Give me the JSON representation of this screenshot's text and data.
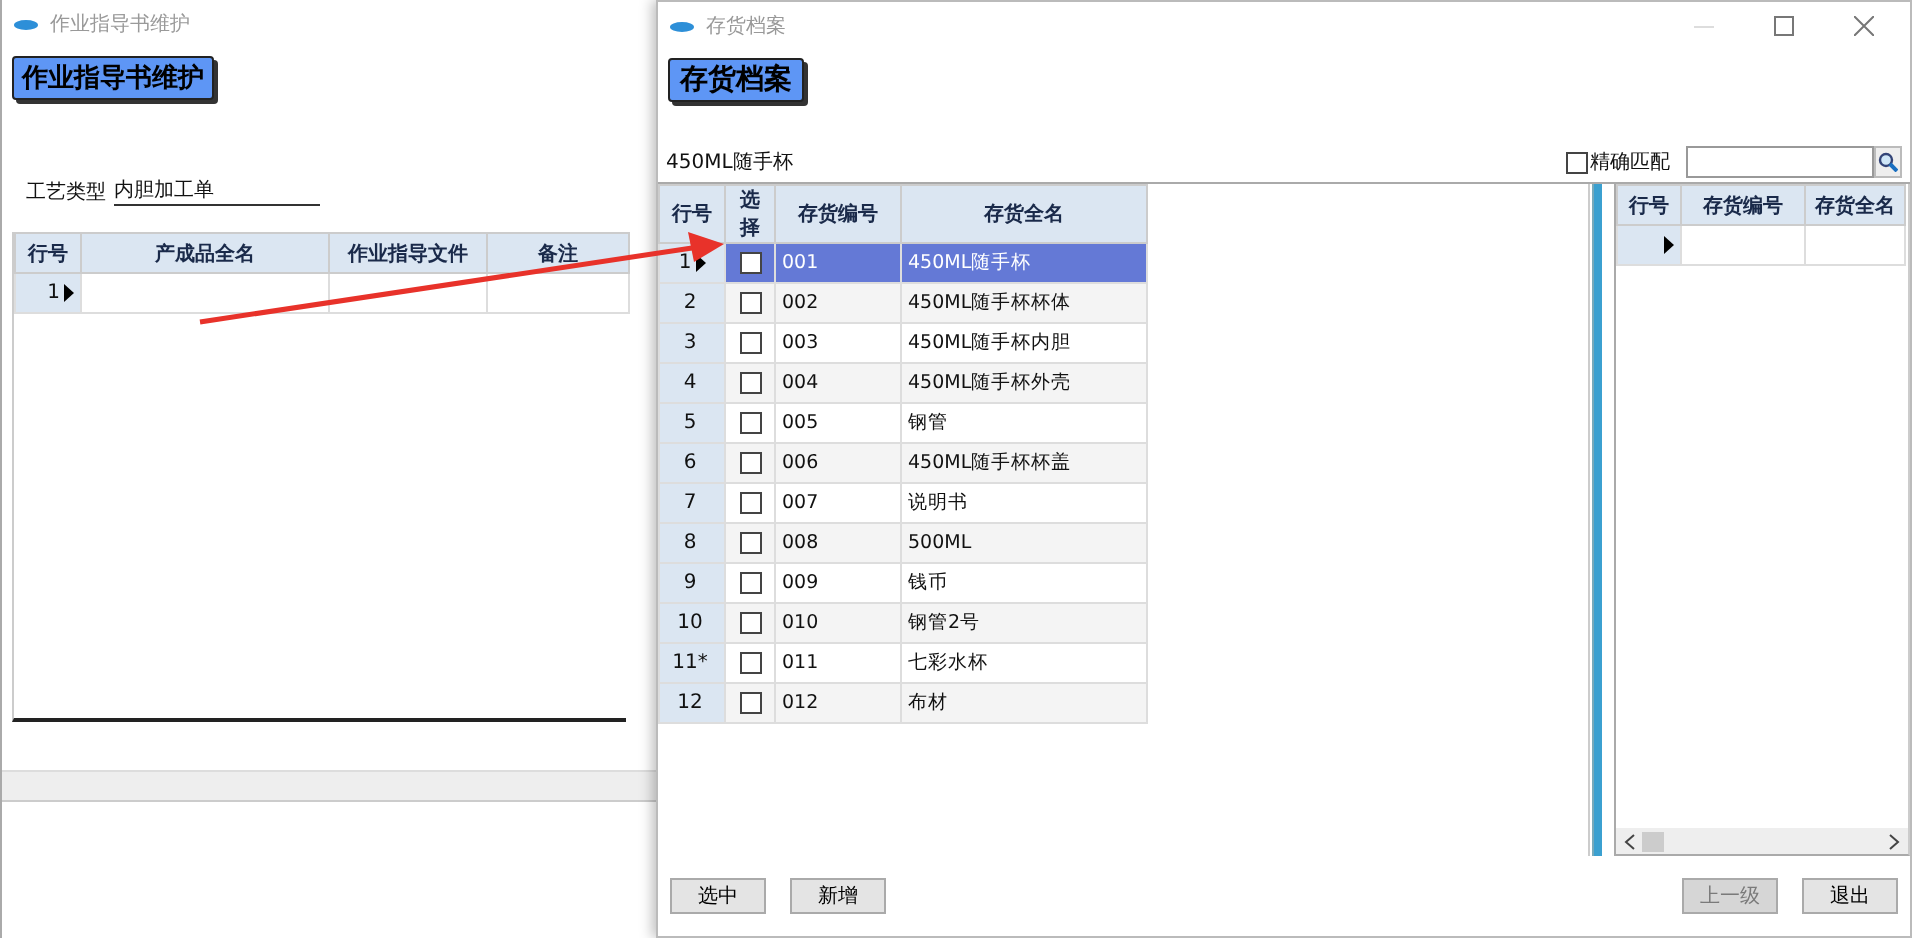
{
  "back_window": {
    "title": "作业指导书维护",
    "heading": "作业指导书维护",
    "process_type": {
      "label": "工艺类型",
      "value": "内胆加工单"
    },
    "grid": {
      "columns": [
        "行号",
        "产成品全名",
        "作业指导文件",
        "备注"
      ],
      "rows": [
        {
          "row_no": "1",
          "current": true
        }
      ]
    }
  },
  "front_window": {
    "title": "存货档案",
    "heading": "存货档案",
    "filter_text": "450ML随手杯",
    "exact_match": {
      "label": "精确匹配",
      "checked": false
    },
    "items": {
      "columns": [
        "行号",
        "选择",
        "存货编号",
        "存货全名"
      ],
      "rows": [
        {
          "row_no": "1",
          "code": "001",
          "name": "450ML随手杯",
          "checked": false,
          "selected": true,
          "current": true
        },
        {
          "row_no": "2",
          "code": "002",
          "name": "450ML随手杯杯体",
          "checked": false,
          "selected": false,
          "current": false
        },
        {
          "row_no": "3",
          "code": "003",
          "name": "450ML随手杯内胆",
          "checked": false,
          "selected": false,
          "current": false
        },
        {
          "row_no": "4",
          "code": "004",
          "name": "450ML随手杯外壳",
          "checked": false,
          "selected": false,
          "current": false
        },
        {
          "row_no": "5",
          "code": "005",
          "name": "钢管",
          "checked": false,
          "selected": false,
          "current": false
        },
        {
          "row_no": "6",
          "code": "006",
          "name": "450ML随手杯杯盖",
          "checked": false,
          "selected": false,
          "current": false
        },
        {
          "row_no": "7",
          "code": "007",
          "name": "说明书",
          "checked": false,
          "selected": false,
          "current": false
        },
        {
          "row_no": "8",
          "code": "008",
          "name": "500ML",
          "checked": false,
          "selected": false,
          "current": false
        },
        {
          "row_no": "9",
          "code": "009",
          "name": "钱币",
          "checked": false,
          "selected": false,
          "current": false
        },
        {
          "row_no": "10",
          "code": "010",
          "name": "钢管2号",
          "checked": false,
          "selected": false,
          "current": false
        },
        {
          "row_no": "11*",
          "code": "011",
          "name": "七彩水杯",
          "checked": false,
          "selected": false,
          "current": false
        },
        {
          "row_no": "12",
          "code": "012",
          "name": "布材",
          "checked": false,
          "selected": false,
          "current": false
        }
      ]
    },
    "picked": {
      "columns": [
        "行号",
        "存货编号",
        "存货全名"
      ],
      "rows": [
        {
          "current": true
        }
      ]
    },
    "left_buttons": [
      {
        "label": "选中",
        "disabled": false
      },
      {
        "label": "新增",
        "disabled": false
      }
    ],
    "right_buttons": [
      {
        "label": "上一级",
        "disabled": true
      },
      {
        "label": "退出",
        "disabled": false
      }
    ]
  }
}
